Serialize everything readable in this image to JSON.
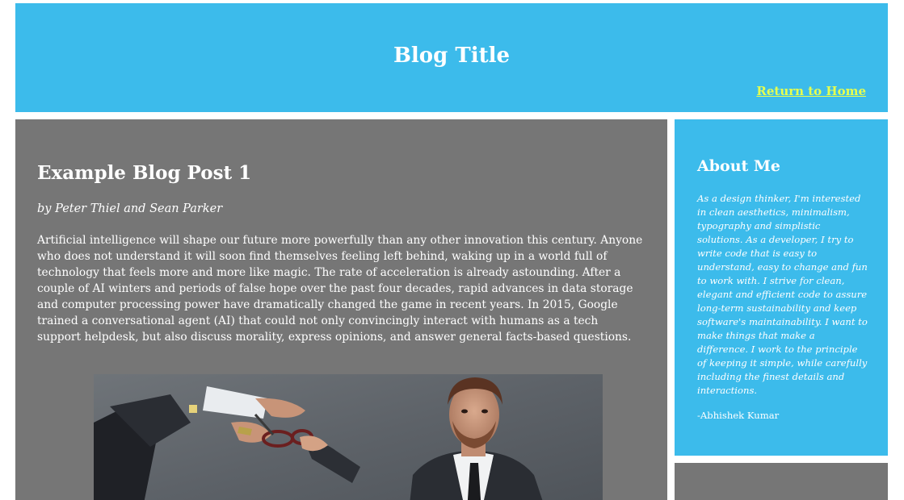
{
  "header": {
    "title": "Blog Title",
    "home_link": "Return to Home"
  },
  "post": {
    "title": "Example Blog Post 1",
    "byline": "by Peter Thiel and Sean Parker",
    "body": "Artificial intelligence will shape our future more powerfully than any other innovation this century. Anyone who does not understand it will soon find themselves feeling left behind, waking up in a world full of technology that feels more and more like magic. The rate of acceleration is already astounding. After a couple of AI winters and periods of false hope over the past four decades, rapid advances in data storage and computer processing power have dramatically changed the game in recent years. In 2015, Google trained a conversational agent (AI) that could not only convincingly interact with humans as a tech support helpdesk, but also discuss morality, express opinions, and answer general facts-based questions."
  },
  "sidebar": {
    "about_title": "About Me",
    "about_text": "As a design thinker, I'm interested in clean aesthetics, minimalism, typography and simplistic solutions. As a developer, I try to write code that is easy to understand, easy to change and fun to work with. I strive for clean, elegant and efficient code to assure long-term sustainability and keep software's maintainability. I want to make things that make a difference. I work to the principle of keeping it simple, while carefully including the finest details and interactions.",
    "signature": "-Abhishek Kumar"
  },
  "colors": {
    "header_bg": "#3cbbeb",
    "main_bg": "#767676",
    "link": "#e6ff4f"
  }
}
